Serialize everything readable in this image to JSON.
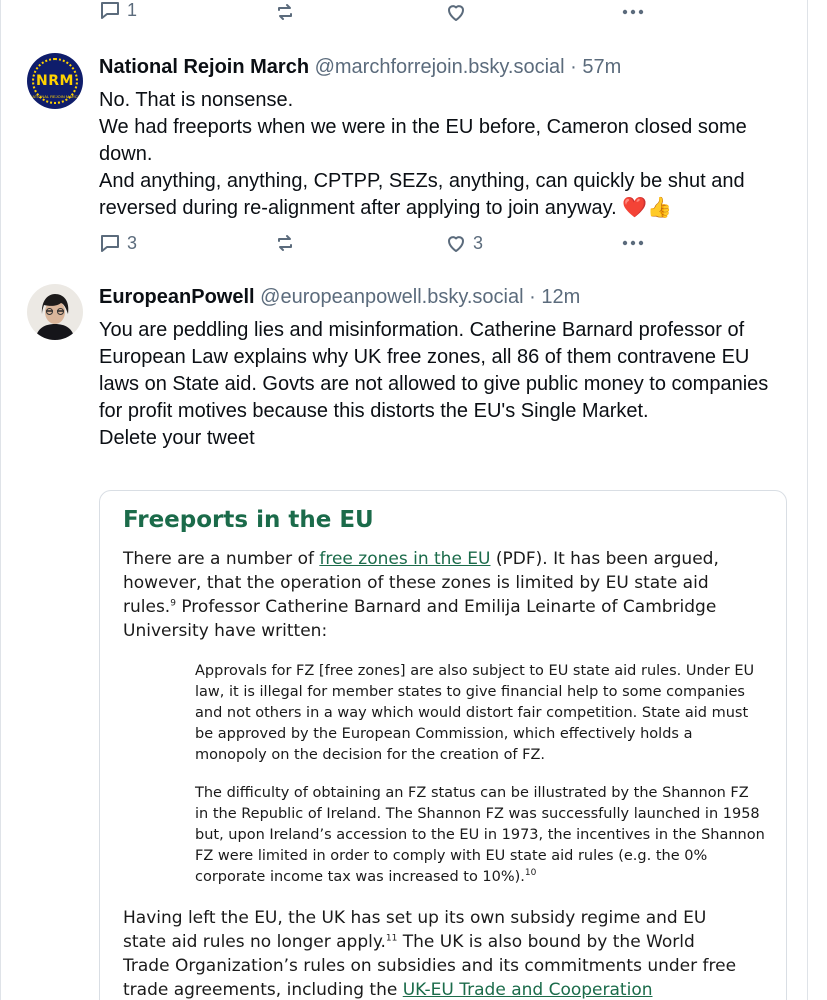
{
  "top_actions": {
    "reply_count": "1"
  },
  "posts": [
    {
      "avatar": {
        "abbr": "NRM",
        "sub": "NATIONAL REJOIN MARCH"
      },
      "name": "National Rejoin March",
      "handle": "@marchforrejoin.bsky.social",
      "time": " · 57m",
      "lines": [
        "No. That is nonsense.",
        "We had freeports when we were in the EU before, Cameron closed some down.",
        "And anything, anything, CPTPP, SEZs, anything, can quickly be shut and reversed during re-alignment after applying to join anyway. ❤️👍"
      ],
      "reply_count": "3",
      "like_count": "3"
    },
    {
      "name": "EuropeanPowell",
      "handle": "@europeanpowell.bsky.social",
      "time": " · 12m",
      "lines": [
        "You are peddling lies and misinformation. Catherine Barnard professor of European Law explains why UK free zones, all 86 of them contravene EU laws on State aid. Govts are not allowed to give public money to companies for profit motives because this distorts the EU's Single Market.",
        "Delete your tweet"
      ]
    }
  ],
  "embed": {
    "title": "Freeports in the EU",
    "p1_a": "There are a number of ",
    "p1_link": "free zones in the EU",
    "p1_b": " (PDF). It has been argued, however, that the operation of these zones is limited by EU state aid rules.",
    "p1_sup": "9",
    "p1_c": " Professor Catherine Barnard and Emilija Leinarte of Cambridge University have written:",
    "q1": "Approvals for FZ [free zones] are also subject to EU state aid rules. Under EU law, it is illegal for member states to give financial help to some companies and not others in a way which would distort fair competition. State aid must be approved by the European Commission, which effectively holds a monopoly on the decision for the creation of FZ.",
    "q2": "The difficulty of obtaining an FZ status can be illustrated by the Shannon FZ in the Republic of Ireland. The Shannon FZ was successfully launched in 1958 but, upon Ireland’s accession to the EU in 1973, the incentives in the Shannon FZ were limited in order to comply with EU state aid rules (e.g. the 0% corporate income tax was increased to 10%).",
    "q2_sup": "10",
    "p2_a": "Having left the EU, the UK has set up its own subsidy regime and EU state aid rules no longer apply.",
    "p2_sup": "11",
    "p2_b": " The UK is also bound by the World Trade Organization’s rules on subsidies and its commitments under free trade agreements, including the ",
    "p2_link": "UK-EU Trade and Cooperation Agreement (TCA)"
  },
  "colors": {
    "accent_green": "#1b6b4a",
    "muted": "#5b6b7c",
    "nrm_blue": "#0f1d6b",
    "nrm_gold": "#ffd200"
  },
  "icons": [
    "reply-icon",
    "repost-icon",
    "like-icon",
    "more-icon",
    "heart-emoji",
    "thumbs-up-emoji"
  ]
}
